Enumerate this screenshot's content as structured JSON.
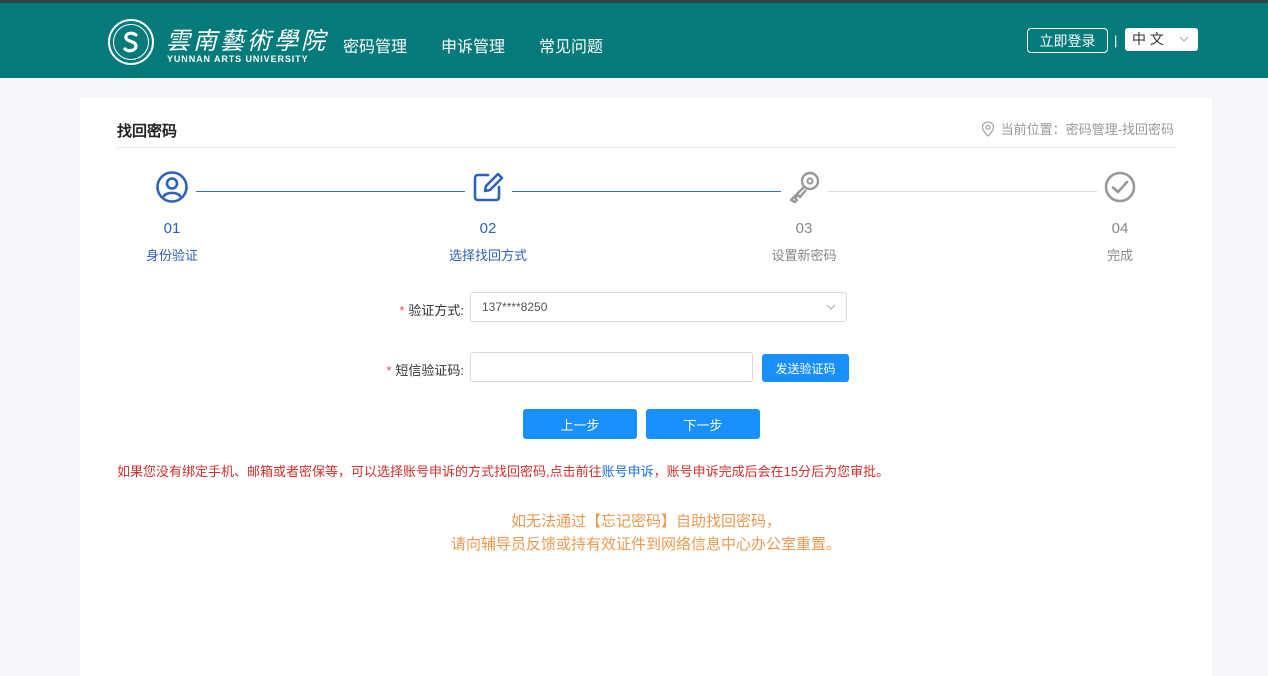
{
  "header": {
    "logo_cn": "雲南藝術學院",
    "logo_en": "YUNNAN ARTS UNIVERSITY",
    "nav": [
      "密码管理",
      "申诉管理",
      "常见问题"
    ],
    "login_label": "立即登录",
    "separator": "|",
    "lang": "中 文"
  },
  "page": {
    "title": "找回密码",
    "breadcrumb": "当前位置：密码管理-找回密码"
  },
  "steps": [
    {
      "num": "01",
      "label": "身份验证",
      "icon": "user-circle-icon",
      "state": "done"
    },
    {
      "num": "02",
      "label": "选择找回方式",
      "icon": "edit-icon",
      "state": "active"
    },
    {
      "num": "03",
      "label": "设置新密码",
      "icon": "key-icon",
      "state": "pending"
    },
    {
      "num": "04",
      "label": "完成",
      "icon": "check-circle-icon",
      "state": "pending"
    }
  ],
  "form": {
    "method_label": "验证方式:",
    "method_value": "137****8250",
    "sms_label": "短信验证码:",
    "sms_value": "",
    "send_label": "发送验证码",
    "required_mark": "*"
  },
  "buttons": {
    "prev": "上一步",
    "next": "下一步"
  },
  "notice": {
    "before": "如果您没有绑定手机、邮箱或者密保等，可以选择账号申诉的方式找回密码,点击前往",
    "link": "账号申诉",
    "after": "，账号申诉完成后会在15分后为您审批。"
  },
  "help": {
    "line1": "如无法通过【忘记密码】自助找回密码，",
    "line2": "请向辅导员反馈或持有效证件到网络信息中心办公室重置。"
  },
  "colors": {
    "header_bg": "#047a7a",
    "primary": "#1890ff",
    "step_active": "#2d62b8",
    "notice": "#d0302a",
    "help": "#ea9a50"
  }
}
